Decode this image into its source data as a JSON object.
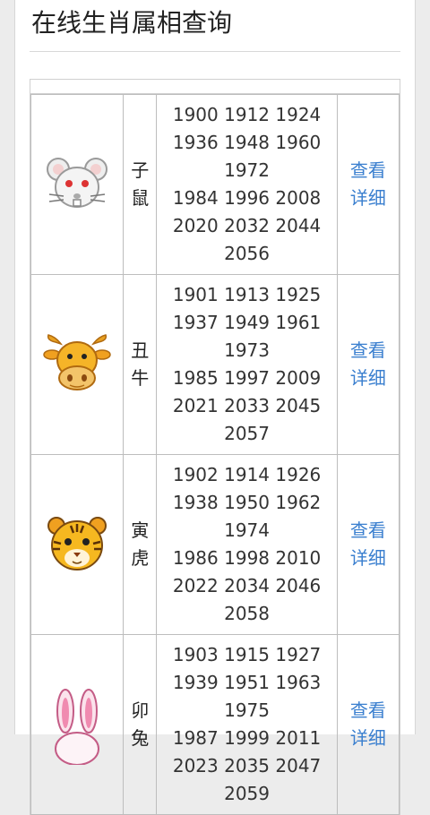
{
  "page": {
    "title": "在线生肖属相查询"
  },
  "zodiac": [
    {
      "name": [
        "子",
        "鼠"
      ],
      "icon": "rat-icon",
      "years": [
        "1900 1912 1924",
        "1936 1948 1960",
        "1972",
        "1984 1996 2008",
        "2020 2032 2044",
        "2056"
      ],
      "link": [
        "查看",
        "详细"
      ]
    },
    {
      "name": [
        "丑",
        "牛"
      ],
      "icon": "ox-icon",
      "years": [
        "1901 1913 1925",
        "1937 1949 1961",
        "1973",
        "1985 1997 2009",
        "2021 2033 2045",
        "2057"
      ],
      "link": [
        "查看",
        "详细"
      ]
    },
    {
      "name": [
        "寅",
        "虎"
      ],
      "icon": "tiger-icon",
      "years": [
        "1902 1914 1926",
        "1938 1950 1962",
        "1974",
        "1986 1998 2010",
        "2022 2034 2046",
        "2058"
      ],
      "link": [
        "查看",
        "详细"
      ]
    },
    {
      "name": [
        "卯",
        "兔"
      ],
      "icon": "rabbit-icon",
      "years": [
        "1903 1915 1927",
        "1939 1951 1963",
        "1975",
        "1987 1999 2011",
        "2023 2035 2047",
        "2059"
      ],
      "link": [
        "查看",
        "详细"
      ]
    }
  ],
  "colors": {
    "link": "#3a7fcf",
    "border": "#bdbdbd"
  }
}
